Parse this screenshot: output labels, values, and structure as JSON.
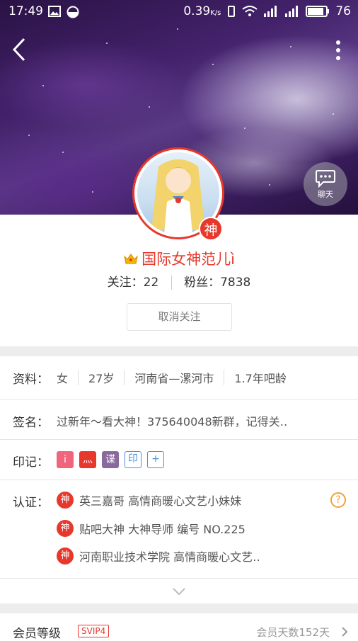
{
  "status_bar": {
    "time": "17:49",
    "net_speed": "0.39",
    "net_unit": "K/s",
    "battery": "76"
  },
  "profile": {
    "name": "国际女神范儿ì",
    "badge_char": "神",
    "following_label": "关注：",
    "following_count": "22",
    "fans_label": "粉丝：",
    "fans_count": "7838",
    "unfollow_label": "取消关注",
    "chat_label": "聊天"
  },
  "info": {
    "label": "资料：",
    "gender": "女",
    "age": "27岁",
    "location": "河南省—漯河市",
    "bar_age": "1.7年吧龄"
  },
  "signature": {
    "label": "签名：",
    "text": "过新年～看大神！375640048新群，记得关‥"
  },
  "marks": {
    "label": "印记：",
    "tags": [
      {
        "text": "i",
        "color": "#f0657b"
      },
      {
        "text": "灬",
        "color": "#e8372b"
      },
      {
        "text": "谍",
        "color": "#8a6a9c"
      },
      {
        "text": "印",
        "color": "#4a90d9"
      },
      {
        "text": "+",
        "color": "#4a90d9"
      }
    ]
  },
  "certification": {
    "label": "认证：",
    "items": [
      "英三嘉哥  高情商暖心文艺小妹妹",
      "贴吧大神  大神导师  编号 NO.225",
      "河南职业技术学院  高情商暖心文艺‥"
    ],
    "icon_char": "神",
    "help_icon": "?"
  },
  "member": {
    "label": "会员等级",
    "level": "SVIP4",
    "days": "会员天数152天"
  },
  "colors": {
    "accent": "#e8372b",
    "help": "#f0a23a"
  }
}
